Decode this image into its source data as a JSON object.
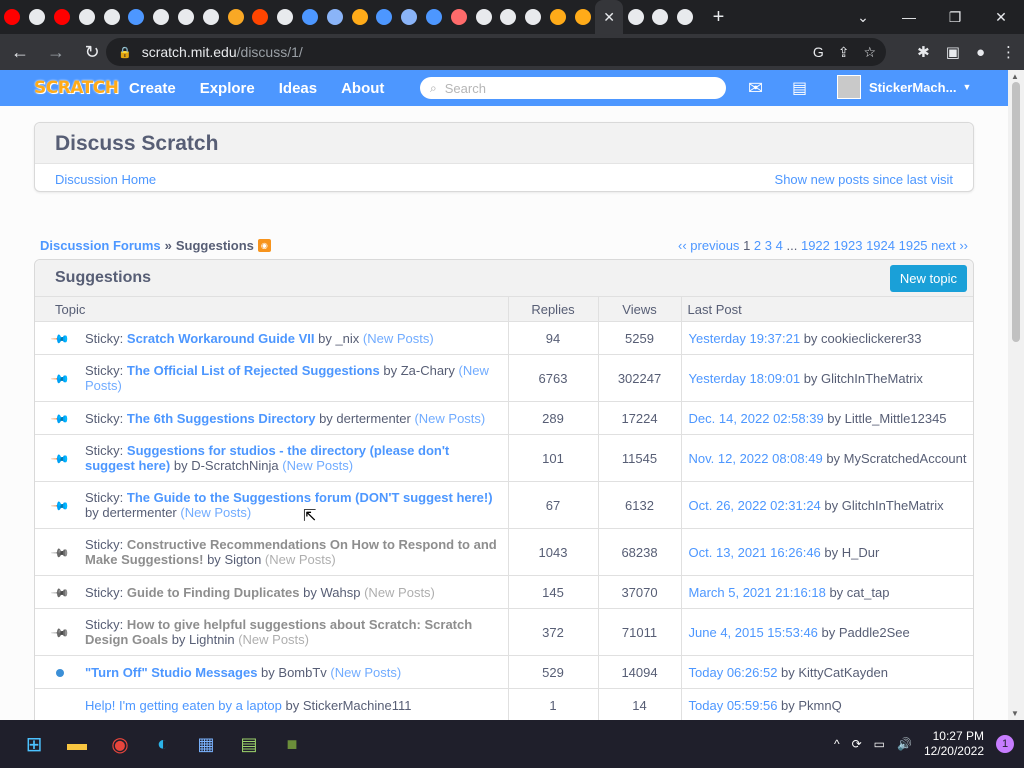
{
  "browser": {
    "url_host": "scratch.mit.edu",
    "url_path": "/discuss/1/",
    "new_tab_glyph": "+"
  },
  "nav": {
    "logo_text": "SCRATCH",
    "links": [
      "Create",
      "Explore",
      "Ideas",
      "About"
    ],
    "search_placeholder": "Search",
    "username": "StickerMach..."
  },
  "header": {
    "title": "Discuss Scratch",
    "home_link": "Discussion Home",
    "new_posts_link": "Show new posts since last visit"
  },
  "breadcrumb": {
    "forums": "Discussion Forums",
    "separator": "»",
    "current": "Suggestions"
  },
  "pager": {
    "previous": "‹‹ previous",
    "current": "1",
    "pages": [
      "2",
      "3",
      "4"
    ],
    "ellipsis": "...",
    "tail_pages": [
      "1922",
      "1923",
      "1924",
      "1925"
    ],
    "next": "next ››"
  },
  "board": {
    "title": "Suggestions",
    "new_topic": "New topic",
    "columns": {
      "topic": "Topic",
      "replies": "Replies",
      "views": "Views",
      "last_post": "Last Post"
    },
    "by": "by",
    "rows": [
      {
        "icon": "pin",
        "prefix": "Sticky:",
        "title": "Scratch Workaround Guide VII",
        "author": "_nix",
        "new_posts": "(New Posts)",
        "replies": "94",
        "views": "5259",
        "last_time": "Yesterday 19:37:21",
        "last_user": "cookieclickerer33"
      },
      {
        "icon": "pin",
        "prefix": "Sticky:",
        "title": "The Official List of Rejected Suggestions",
        "author": "Za-Chary",
        "new_posts": "(New Posts)",
        "replies": "6763",
        "views": "302247",
        "last_time": "Yesterday 18:09:01",
        "last_user": "GlitchInTheMatrix"
      },
      {
        "icon": "pin",
        "prefix": "Sticky:",
        "title": "The 6th Suggestions Directory",
        "author": "dertermenter",
        "new_posts": "(New Posts)",
        "replies": "289",
        "views": "17224",
        "last_time": "Dec. 14, 2022 02:58:39",
        "last_user": "Little_Mittle12345"
      },
      {
        "icon": "pin",
        "prefix": "Sticky:",
        "title": "Suggestions for studios - the directory (please don't suggest here)",
        "author": "D-ScratchNinja",
        "new_posts": "(New Posts)",
        "replies": "101",
        "views": "11545",
        "last_time": "Nov. 12, 2022 08:08:49",
        "last_user": "MyScratchedAccount"
      },
      {
        "icon": "pin",
        "prefix": "Sticky:",
        "title": "The Guide to the Suggestions forum (DON'T suggest here!)",
        "author": "dertermenter",
        "new_posts": "(New Posts)",
        "replies": "67",
        "views": "6132",
        "last_time": "Oct. 26, 2022 02:31:24",
        "last_user": "GlitchInTheMatrix"
      },
      {
        "icon": "pin-gray",
        "prefix": "Sticky:",
        "title": "Constructive Recommendations On How to Respond to and Make Suggestions!",
        "author": "Sigton",
        "new_posts": "(New Posts)",
        "replies": "1043",
        "views": "68238",
        "last_time": "Oct. 13, 2021 16:26:46",
        "last_user": "H_Dur"
      },
      {
        "icon": "pin-gray",
        "prefix": "Sticky:",
        "title": "Guide to Finding Duplicates",
        "author": "Wahsp",
        "new_posts": "(New Posts)",
        "replies": "145",
        "views": "37070",
        "last_time": "March 5, 2021 21:16:18",
        "last_user": "cat_tap"
      },
      {
        "icon": "pin-gray",
        "prefix": "Sticky:",
        "title": "How to give helpful suggestions about Scratch: Scratch Design Goals",
        "author": "Lightnin",
        "new_posts": "(New Posts)",
        "replies": "372",
        "views": "71011",
        "last_time": "June 4, 2015 15:53:46",
        "last_user": "Paddle2See"
      },
      {
        "icon": "dot",
        "prefix": "",
        "title": "\"Turn Off\" Studio Messages",
        "author": "BombTv",
        "new_posts": "(New Posts)",
        "replies": "529",
        "views": "14094",
        "last_time": "Today 06:26:52",
        "last_user": "KittyCatKayden"
      },
      {
        "icon": "none",
        "prefix": "",
        "title": "Help! I'm getting eaten by a laptop",
        "author": "StickerMachine111",
        "new_posts": "",
        "replies": "1",
        "views": "14",
        "last_time": "Today 05:59:56",
        "last_user": "PkmnQ"
      }
    ]
  },
  "taskbar": {
    "time": "10:27 PM",
    "date": "12/20/2022",
    "notifications": "1"
  },
  "colors": {
    "scratch_blue": "#4d97ff",
    "new_topic_button": "#1aa0d8",
    "chrome_dark": "#202124"
  }
}
